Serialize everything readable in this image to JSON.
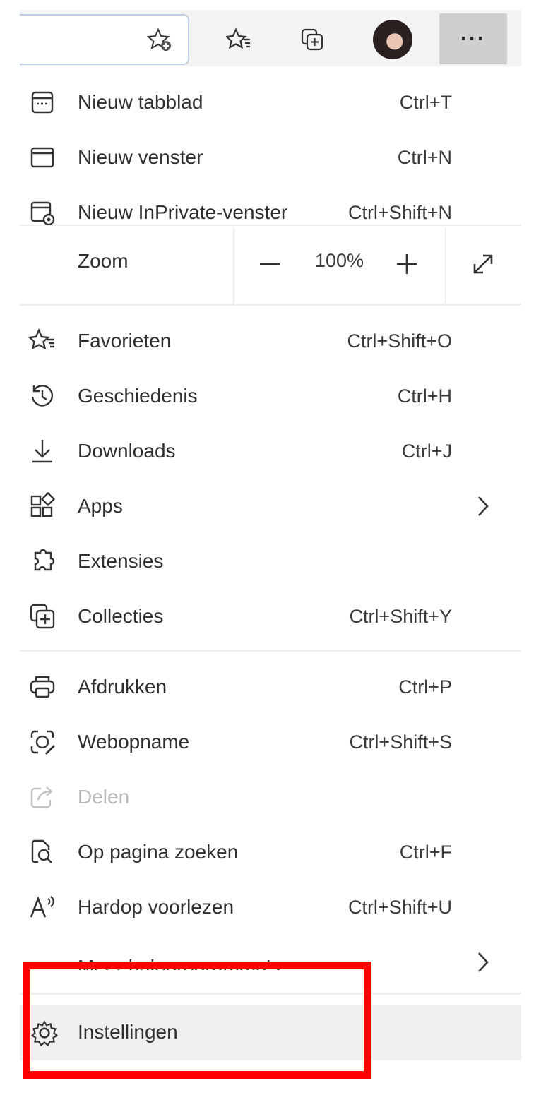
{
  "toolbar": {
    "icons": [
      "favorite-add-icon",
      "favorites-icon",
      "collections-icon",
      "profile-avatar",
      "more-options-icon"
    ],
    "more_label": "···"
  },
  "menu": {
    "items_top": [
      {
        "label": "Nieuw tabblad",
        "shortcut": "Ctrl+T",
        "icon": "new-tab-icon"
      },
      {
        "label": "Nieuw venster",
        "shortcut": "Ctrl+N",
        "icon": "new-window-icon"
      },
      {
        "label": "Nieuw InPrivate-venster",
        "shortcut": "Ctrl+Shift+N",
        "icon": "inprivate-window-icon"
      }
    ],
    "zoom": {
      "label": "Zoom",
      "value": "100%",
      "minus": "−",
      "plus": "+"
    },
    "items_mid": [
      {
        "label": "Favorieten",
        "shortcut": "Ctrl+Shift+O",
        "icon": "favorites-icon"
      },
      {
        "label": "Geschiedenis",
        "shortcut": "Ctrl+H",
        "icon": "history-icon"
      },
      {
        "label": "Downloads",
        "shortcut": "Ctrl+J",
        "icon": "download-icon"
      },
      {
        "label": "Apps",
        "shortcut": "",
        "icon": "apps-icon",
        "submenu": true
      },
      {
        "label": "Extensies",
        "shortcut": "",
        "icon": "extensions-icon"
      },
      {
        "label": "Collecties",
        "shortcut": "Ctrl+Shift+Y",
        "icon": "collections-icon"
      }
    ],
    "items_bottom": [
      {
        "label": "Afdrukken",
        "shortcut": "Ctrl+P",
        "icon": "print-icon"
      },
      {
        "label": "Webopname",
        "shortcut": "Ctrl+Shift+S",
        "icon": "web-capture-icon"
      },
      {
        "label": "Delen",
        "shortcut": "",
        "icon": "share-icon",
        "disabled": true
      },
      {
        "label": "Op pagina zoeken",
        "shortcut": "Ctrl+F",
        "icon": "find-on-page-icon"
      },
      {
        "label": "Hardop voorlezen",
        "shortcut": "Ctrl+Shift+U",
        "icon": "read-aloud-icon"
      }
    ],
    "more_tools": {
      "label": "Meer hulpprogramma's",
      "icon": "more-tools-icon"
    },
    "settings": {
      "label": "Instellingen",
      "icon": "gear-icon"
    }
  },
  "highlight": {
    "color": "#ff0000"
  }
}
